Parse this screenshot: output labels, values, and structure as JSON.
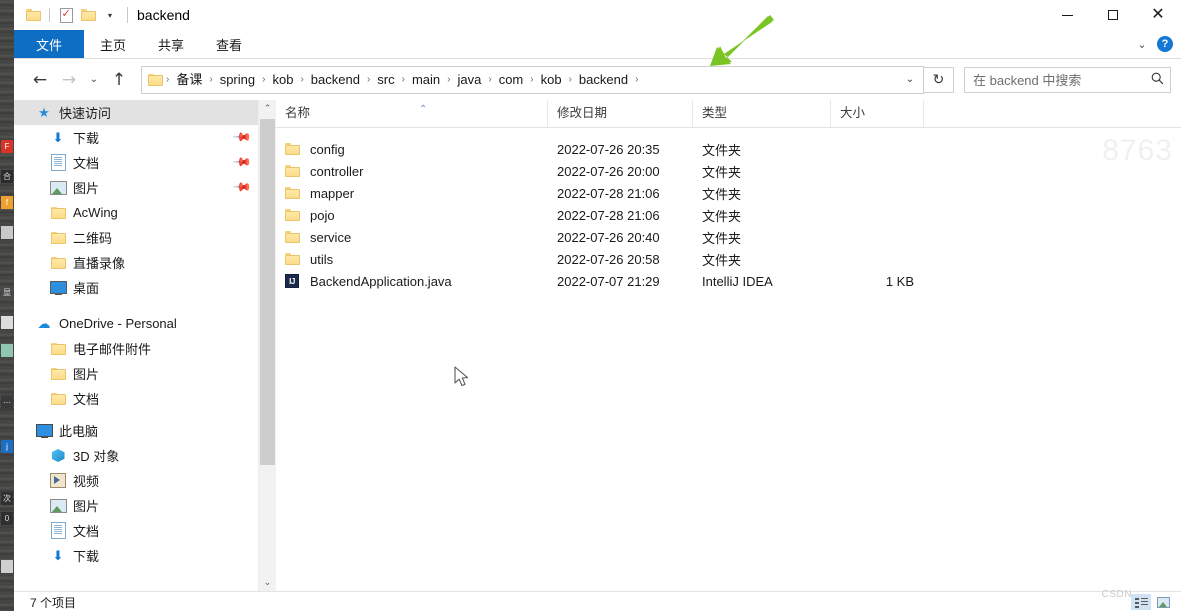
{
  "window": {
    "title": "backend",
    "quick_access": {
      "folder_icon": "folder-icon",
      "properties_icon": "properties-checkmark-icon",
      "new_folder_icon": "new-folder-icon",
      "customize_caret": "▾"
    },
    "controls": {
      "minimize": "minimize-icon",
      "maximize": "maximize-icon",
      "close": "✕"
    }
  },
  "ribbon": {
    "tabs": [
      {
        "label": "文件",
        "active": true
      },
      {
        "label": "主页",
        "active": false
      },
      {
        "label": "共享",
        "active": false
      },
      {
        "label": "查看",
        "active": false
      }
    ],
    "collapse_caret": "⌄",
    "help_label": "?"
  },
  "address_bar": {
    "back": "←",
    "forward": "→",
    "recent": "⌄",
    "up": "↑",
    "breadcrumb": [
      "备课",
      "spring",
      "kob",
      "backend",
      "src",
      "main",
      "java",
      "com",
      "kob",
      "backend"
    ],
    "separator": "›",
    "dropdown_caret": "⌄",
    "refresh": "↻"
  },
  "search": {
    "placeholder": "在 backend 中搜索",
    "icon": "search-icon"
  },
  "nav_pane": {
    "items": [
      {
        "label": "快速访问",
        "icon": "star-pin-icon",
        "level": 0,
        "selected": true,
        "pinned": false
      },
      {
        "label": "下载",
        "icon": "download-icon",
        "level": 1,
        "selected": false,
        "pinned": true
      },
      {
        "label": "文档",
        "icon": "document-icon",
        "level": 1,
        "selected": false,
        "pinned": true
      },
      {
        "label": "图片",
        "icon": "pictures-icon",
        "level": 1,
        "selected": false,
        "pinned": true
      },
      {
        "label": "AcWing",
        "icon": "folder-icon",
        "level": 1,
        "selected": false,
        "pinned": false
      },
      {
        "label": "二维码",
        "icon": "folder-icon",
        "level": 1,
        "selected": false,
        "pinned": false
      },
      {
        "label": "直播录像",
        "icon": "folder-icon",
        "level": 1,
        "selected": false,
        "pinned": false
      },
      {
        "label": "桌面",
        "icon": "desktop-icon",
        "level": 1,
        "selected": false,
        "pinned": false
      },
      {
        "label": "OneDrive - Personal",
        "icon": "cloud-icon",
        "level": 0,
        "selected": false,
        "pinned": false
      },
      {
        "label": "电子邮件附件",
        "icon": "folder-icon",
        "level": 1,
        "selected": false,
        "pinned": false
      },
      {
        "label": "图片",
        "icon": "folder-icon",
        "level": 1,
        "selected": false,
        "pinned": false
      },
      {
        "label": "文档",
        "icon": "folder-icon",
        "level": 1,
        "selected": false,
        "pinned": false
      },
      {
        "label": "此电脑",
        "icon": "this-pc-icon",
        "level": 0,
        "selected": false,
        "pinned": false
      },
      {
        "label": "3D 对象",
        "icon": "3d-objects-icon",
        "level": 1,
        "selected": false,
        "pinned": false
      },
      {
        "label": "视频",
        "icon": "videos-icon",
        "level": 1,
        "selected": false,
        "pinned": false
      },
      {
        "label": "图片",
        "icon": "pictures-icon",
        "level": 1,
        "selected": false,
        "pinned": false
      },
      {
        "label": "文档",
        "icon": "document-icon",
        "level": 1,
        "selected": false,
        "pinned": false
      },
      {
        "label": "下载",
        "icon": "download-icon",
        "level": 1,
        "selected": false,
        "pinned": false
      }
    ],
    "scroll_up": "⌃",
    "scroll_down": "⌄"
  },
  "file_list": {
    "columns": [
      {
        "label": "名称",
        "sorted": true,
        "sort_caret": "⌃"
      },
      {
        "label": "修改日期",
        "sorted": false
      },
      {
        "label": "类型",
        "sorted": false
      },
      {
        "label": "大小",
        "sorted": false
      }
    ],
    "rows": [
      {
        "name": "config",
        "date": "2022-07-26 20:35",
        "type": "文件夹",
        "size": "",
        "icon": "folder-icon"
      },
      {
        "name": "controller",
        "date": "2022-07-26 20:00",
        "type": "文件夹",
        "size": "",
        "icon": "folder-icon"
      },
      {
        "name": "mapper",
        "date": "2022-07-28 21:06",
        "type": "文件夹",
        "size": "",
        "icon": "folder-icon"
      },
      {
        "name": "pojo",
        "date": "2022-07-28 21:06",
        "type": "文件夹",
        "size": "",
        "icon": "folder-icon"
      },
      {
        "name": "service",
        "date": "2022-07-26 20:40",
        "type": "文件夹",
        "size": "",
        "icon": "folder-icon"
      },
      {
        "name": "utils",
        "date": "2022-07-26 20:58",
        "type": "文件夹",
        "size": "",
        "icon": "folder-icon"
      },
      {
        "name": "BackendApplication.java",
        "date": "2022-07-07 21:29",
        "type": "IntelliJ IDEA",
        "size": "1 KB",
        "icon": "intellij-idea-icon"
      }
    ]
  },
  "status_bar": {
    "item_count": "7 个项目",
    "view_details_icon": "details-view-icon",
    "view_icons_icon": "large-icons-view-icon"
  },
  "overlays": {
    "watermark_number": "8763",
    "csdn_watermark": "CSDN",
    "annotation_arrow": "green-arrow-annotation",
    "cursor": "mouse-pointer"
  },
  "colors": {
    "accent_blue": "#0d6ec4",
    "folder_yellow": "#fbdc8a",
    "selection_grey": "#e2e2e2",
    "annotation_green": "#7ac424"
  }
}
